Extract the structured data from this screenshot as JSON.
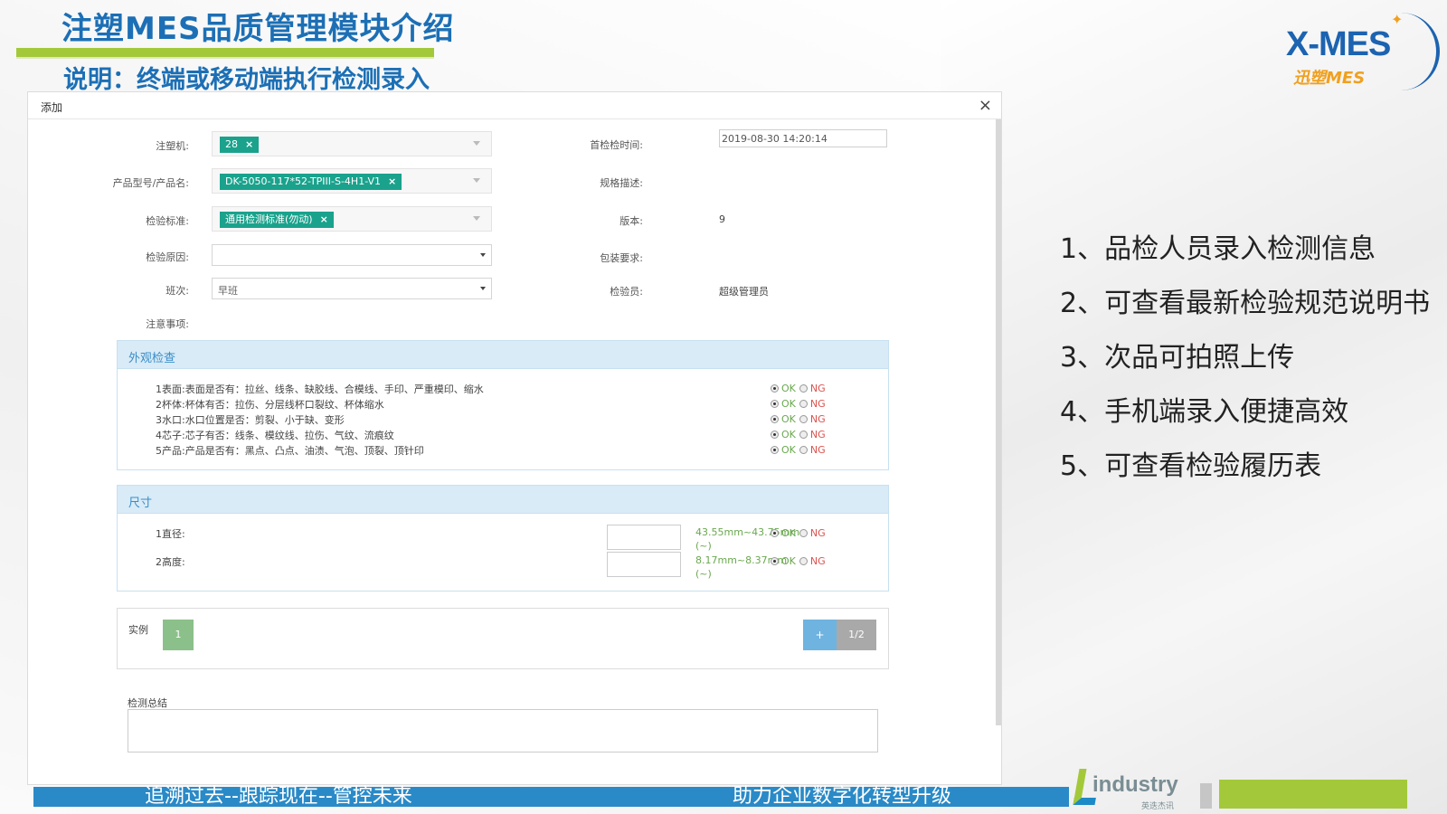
{
  "slide": {
    "title": "注塑MES品质管理模块介绍",
    "subtitle": "说明：终端或移动端执行检测录入",
    "logo_main": "X-MES",
    "logo_sub": "迅塑MES",
    "points": [
      "1、品检人员录入检测信息",
      "2、可查看最新检验规范说明书",
      "3、次品可拍照上传",
      "4、手机端录入便捷高效",
      "5、可查看检验履历表"
    ],
    "footer_left": "追溯过去--跟踪现在--管控未来",
    "footer_right": "助力企业数字化转型升级",
    "footer_logo": "industry",
    "footer_logo_sub": "英迭杰讯"
  },
  "dialog": {
    "title": "添加",
    "close": "×",
    "form": {
      "machine_label": "注塑机:",
      "machine_tag": "28",
      "product_label": "产品型号/产品名:",
      "product_tag": "DK-5050-117*52-TPIII-S-4H1-V1",
      "standard_label": "检验标准:",
      "standard_tag": "通用检测标准(勿动)",
      "reason_label": "检验原因:",
      "shift_label": "班次:",
      "shift_value": "早班",
      "notes_label": "注意事项:",
      "first_check_label": "首检检时间:",
      "first_check_value": "2019-08-30 14:20:14",
      "spec_label": "规格描述:",
      "version_label": "版本:",
      "version_value": "9",
      "package_label": "包装要求:",
      "inspector_label": "检验员:",
      "inspector_value": "超级管理员"
    },
    "appearance": {
      "title": "外观检查",
      "items": [
        "1表面:表面是否有：拉丝、线条、缺胶线、合模线、手印、严重模印、缩水",
        "2杯体:杯体有否：拉伤、分层线杯口裂纹、杯体缩水",
        "3水口:水口位置是否：剪裂、小于缺、变形",
        "4芯子:芯子有否：线条、模纹线、拉伤、气纹、流痕纹",
        "5产品:产品是否有：黑点、凸点、油渍、气泡、顶裂、顶针印"
      ],
      "ok_label": "OK",
      "ng_label": "NG"
    },
    "dimension": {
      "title": "尺寸",
      "items": [
        {
          "label": "1直径:",
          "range": "43.55mm~43.75mm",
          "range2": "(~)"
        },
        {
          "label": "2高度:",
          "range": "8.17mm~8.37mm",
          "range2": "(~)"
        }
      ],
      "ok_label": "OK",
      "ng_label": "NG"
    },
    "example": {
      "label": "实例",
      "thumb": "1",
      "add": "+",
      "page": "1/2"
    },
    "summary_label": "检测总结"
  },
  "colors": {
    "title_blue": "#1c6fb5",
    "accent_green": "#a3c93a",
    "tag_teal": "#1aa28c",
    "panel_head": "#d8ebf7",
    "footer_blue": "#2a8ac7"
  }
}
